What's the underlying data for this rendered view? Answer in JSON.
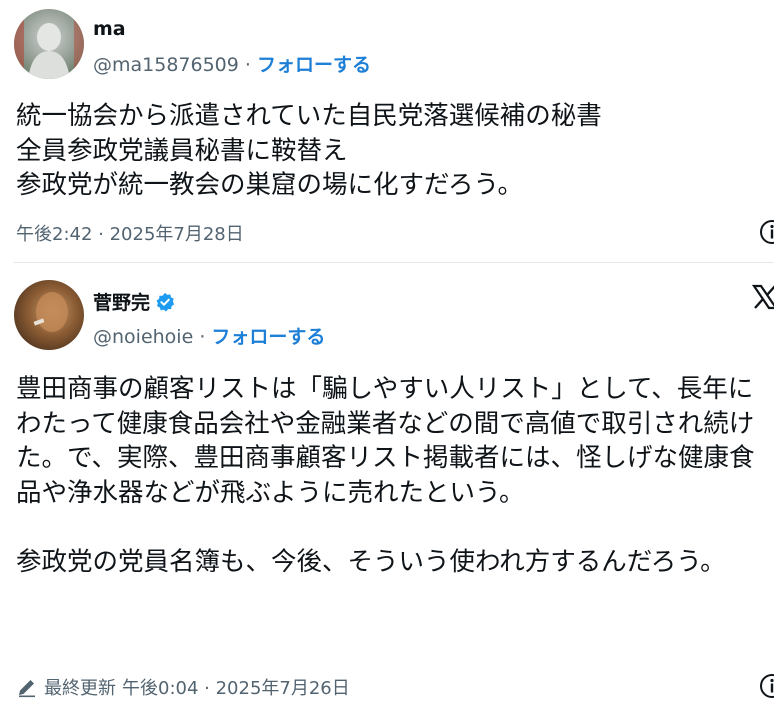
{
  "tweets": [
    {
      "name": "ma",
      "handle": "@ma15876509",
      "separator": "·",
      "follow_label": "フォローする",
      "body": "統一協会から派遣されていた自民党落選候補の秘書\n全員参政党議員秘書に鞍替え\n参政党が統一教会の巣窟の場に化すだろう。",
      "timestamp": "午後2:42 · 2025年7月28日"
    },
    {
      "name": "菅野完",
      "handle": "@noiehoie",
      "separator": "·",
      "follow_label": "フォローする",
      "verified": true,
      "body": "豊田商事の顧客リストは「騙しやすい人リスト」として、長年にわたって健康食品会社や金融業者などの間で高値で取引され続けた。で、実際、豊田商事顧客リスト掲載者には、怪しげな健康食品や浄水器などが飛ぶように売れたという。\n\n参政党の党員名簿も、今後、そういう使われ方するんだろう。",
      "edited_label": "最終更新",
      "timestamp": "午後0:04 · 2025年7月26日"
    }
  ],
  "colors": {
    "text": "#0f1419",
    "secondary": "#536471",
    "follow": "#1d7fd6",
    "verified": "#1d9bf0"
  },
  "icons": [
    "avatar",
    "verified-badge-icon",
    "x-logo-icon",
    "info-icon",
    "pencil-icon"
  ]
}
